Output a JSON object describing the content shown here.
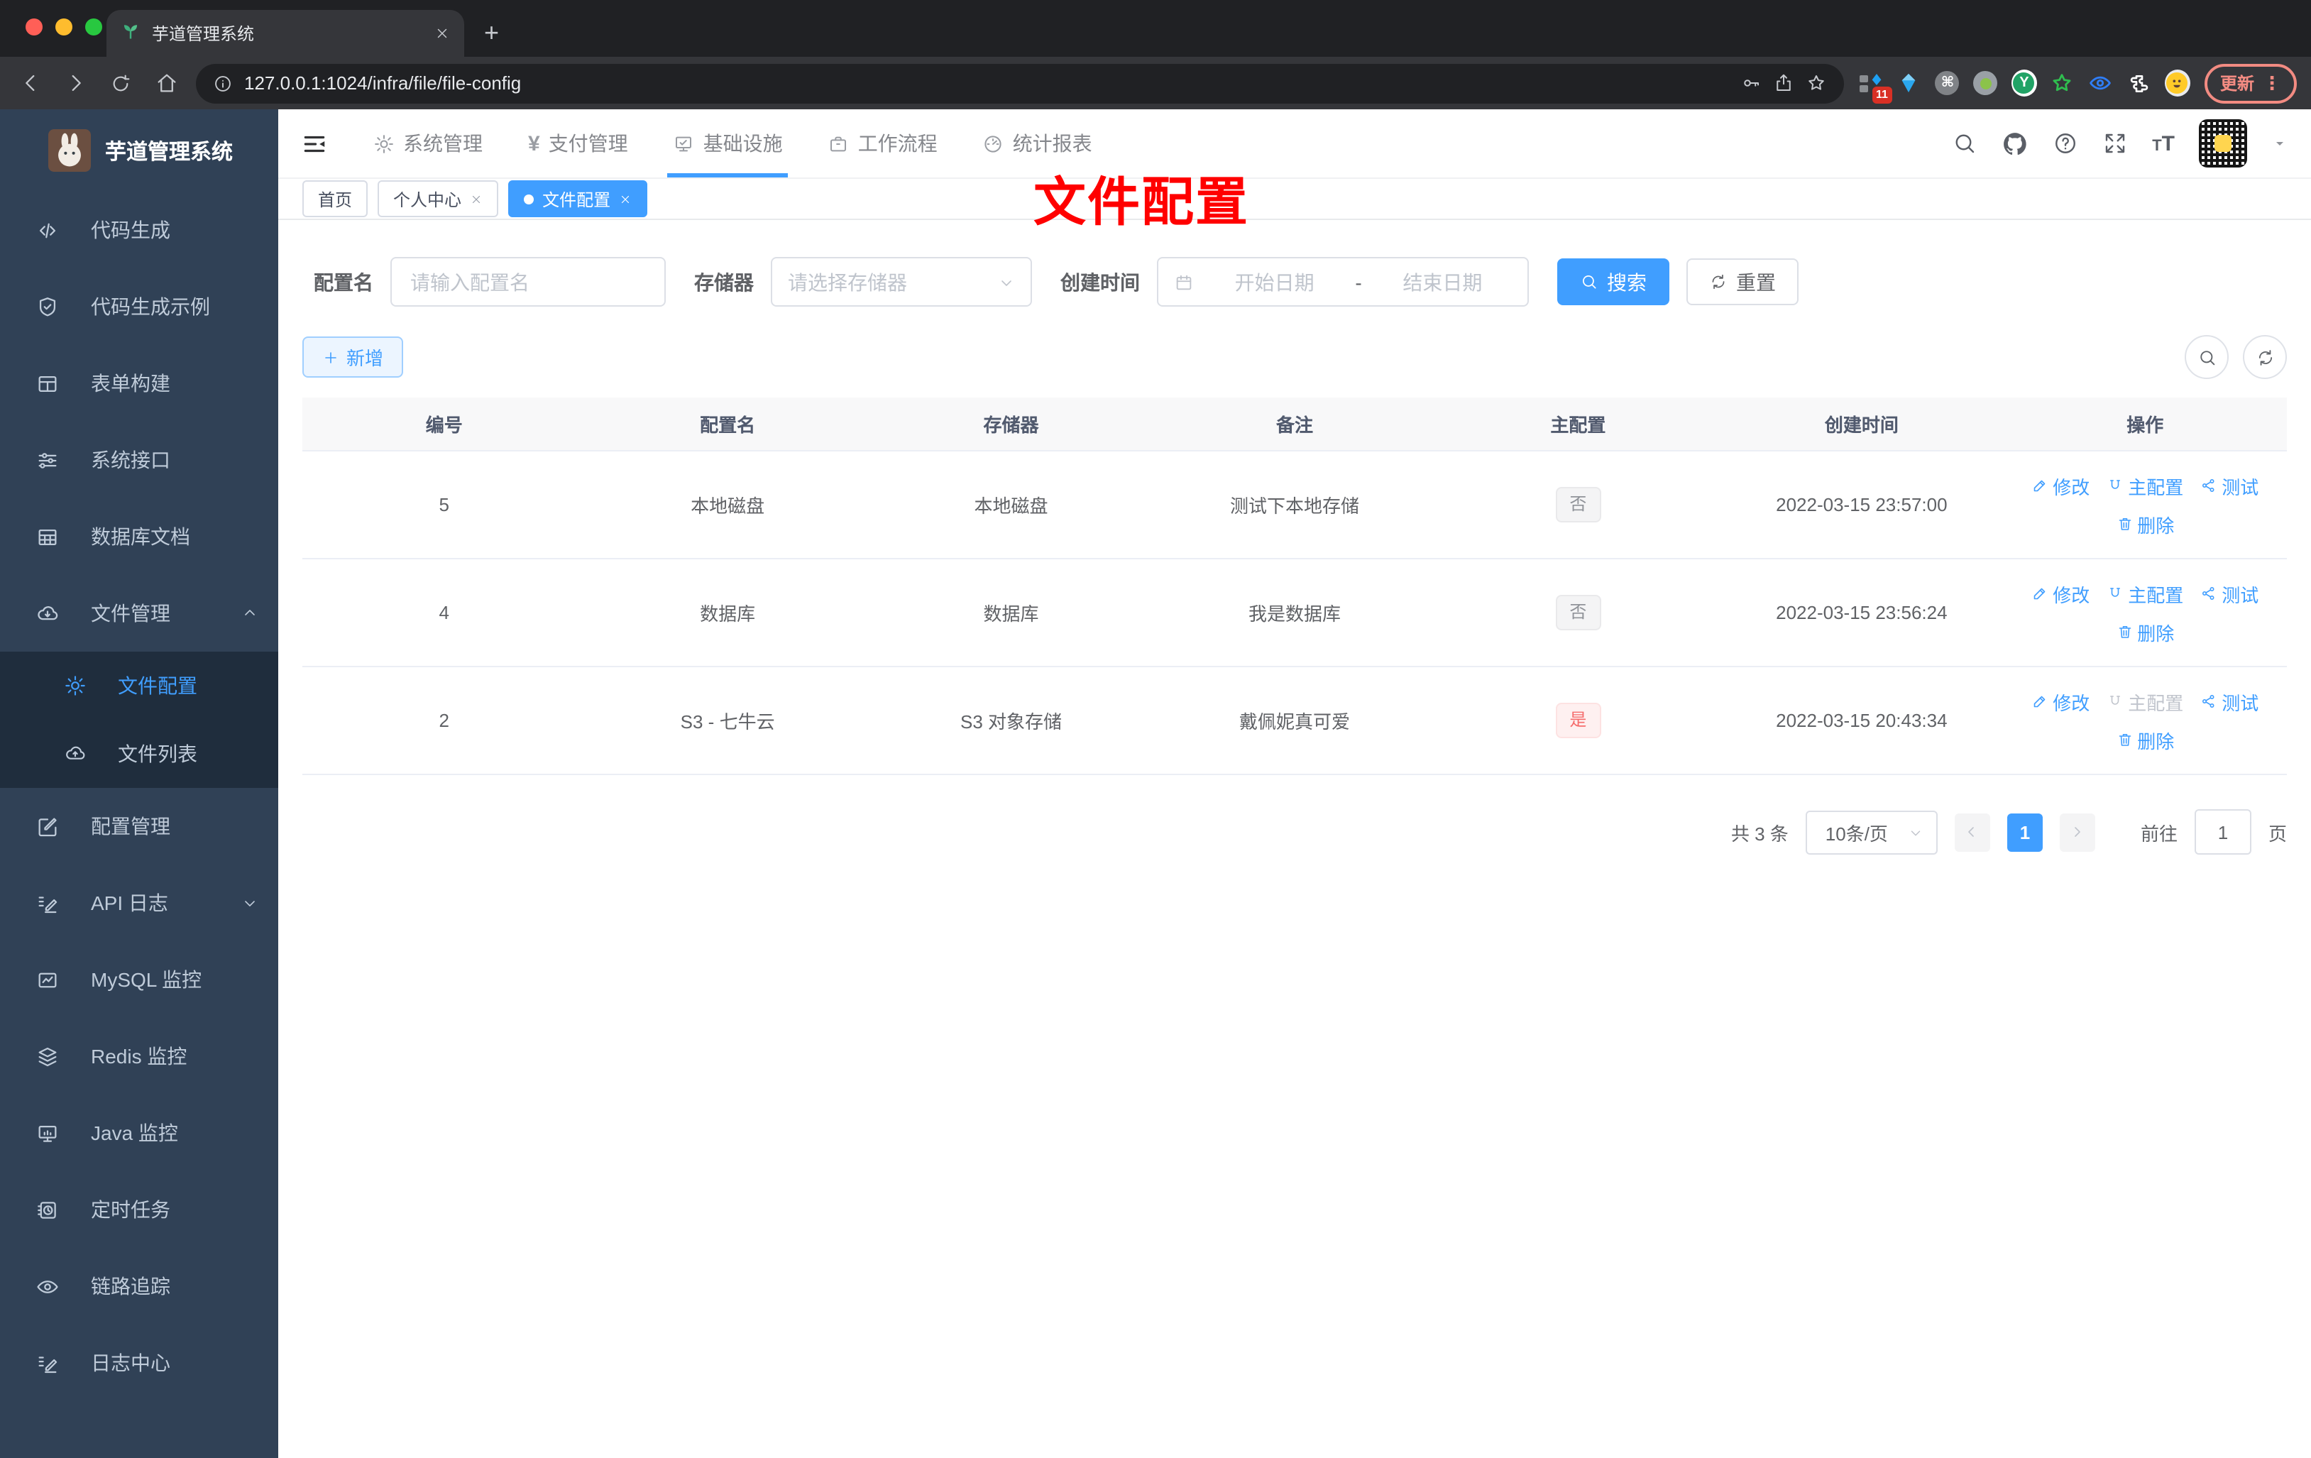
{
  "colors": {
    "primary": "#409eff",
    "sidebar_bg": "#304156",
    "submenu_bg": "#1f2d3d",
    "sidebar_text": "#bfcbd9",
    "danger": "#f56c6c",
    "info_tag_text": "#909399",
    "chrome_bg": "#202124",
    "update_red": "#f28b82",
    "annotation_red": "#ff0000"
  },
  "browser": {
    "tab_title": "芋道管理系统",
    "url": "127.0.0.1:1024/infra/file/file-config",
    "update_label": "更新",
    "extensions_badge": "11"
  },
  "sidebar": {
    "app_title": "芋道管理系统",
    "items": [
      "代码生成",
      "代码生成示例",
      "表单构建",
      "系统接口",
      "数据库文档",
      "文件管理",
      "文件配置",
      "文件列表",
      "配置管理",
      "API 日志",
      "MySQL 监控",
      "Redis 监控",
      "Java 监控",
      "定时任务",
      "链路追踪",
      "日志中心"
    ]
  },
  "topnav": {
    "items": [
      "系统管理",
      "支付管理",
      "基础设施",
      "工作流程",
      "统计报表"
    ]
  },
  "tags": {
    "items": [
      "首页",
      "个人中心",
      "文件配置"
    ]
  },
  "annotation": {
    "text": "文件配置"
  },
  "filters": {
    "name_label": "配置名",
    "name_placeholder": "请输入配置名",
    "storage_label": "存储器",
    "storage_placeholder": "请选择存储器",
    "time_label": "创建时间",
    "start_placeholder": "开始日期",
    "range_separator": "-",
    "end_placeholder": "结束日期",
    "search_label": "搜索",
    "reset_label": "重置"
  },
  "toolbar": {
    "add_label": "新增"
  },
  "table": {
    "columns": [
      "编号",
      "配置名",
      "存储器",
      "备注",
      "主配置",
      "创建时间",
      "操作"
    ],
    "rows": [
      {
        "id": "5",
        "name": "本地磁盘",
        "storage": "本地磁盘",
        "remark": "测试下本地存储",
        "master": "否",
        "created": "2022-03-15 23:57:00"
      },
      {
        "id": "4",
        "name": "数据库",
        "storage": "数据库",
        "remark": "我是数据库",
        "master": "否",
        "created": "2022-03-15 23:56:24"
      },
      {
        "id": "2",
        "name": "S3 - 七牛云",
        "storage": "S3 对象存储",
        "remark": "戴佩妮真可爱",
        "master": "是",
        "created": "2022-03-15 20:43:34"
      }
    ]
  },
  "ops": {
    "edit": "修改",
    "master": "主配置",
    "test": "测试",
    "del": "删除"
  },
  "pagination": {
    "total": "共 3 条",
    "size": "10条/页",
    "page": "1",
    "goto_label": "前往",
    "goto_value": "1",
    "unit": "页"
  }
}
